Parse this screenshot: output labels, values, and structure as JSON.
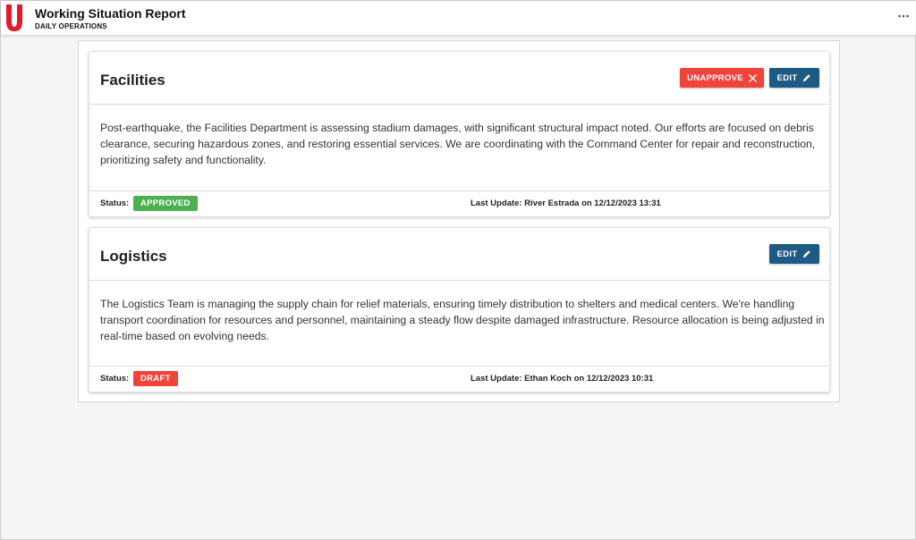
{
  "header": {
    "title": "Working Situation Report",
    "subtitle": "DAILY OPERATIONS",
    "brand_color": "#e31b2b",
    "more_icon": "more-horizontal-icon"
  },
  "cards": [
    {
      "title": "Facilities",
      "buttons": {
        "unapprove_label": "UNAPPROVE",
        "edit_label": "EDIT"
      },
      "body": "Post-earthquake, the Facilities Department is assessing stadium damages, with significant structural impact noted. Our efforts are focused on debris clearance, securing hazardous zones, and restoring essential services. We are coordinating with the Command Center for repair and reconstruction, prioritizing safety and functionality.",
      "status_label": "Status:",
      "status": "APPROVED",
      "status_color": "#4caf50",
      "last_update": "Last Update: River Estrada on 12/12/2023 13:31"
    },
    {
      "title": "Logistics",
      "buttons": {
        "edit_label": "EDIT"
      },
      "body": "The Logistics Team is managing the supply chain for relief materials, ensuring timely distribution to shelters and medical centers. We're handling transport coordination for resources and personnel, maintaining a steady flow despite damaged infrastructure. Resource allocation is being adjusted in real-time based on evolving needs.",
      "status_label": "Status:",
      "status": "DRAFT",
      "status_color": "#f0443a",
      "last_update": "Last Update: Ethan Koch on 12/12/2023 10:31"
    }
  ],
  "colors": {
    "edit_button": "#1d5a84",
    "unapprove_button": "#f0443a"
  }
}
